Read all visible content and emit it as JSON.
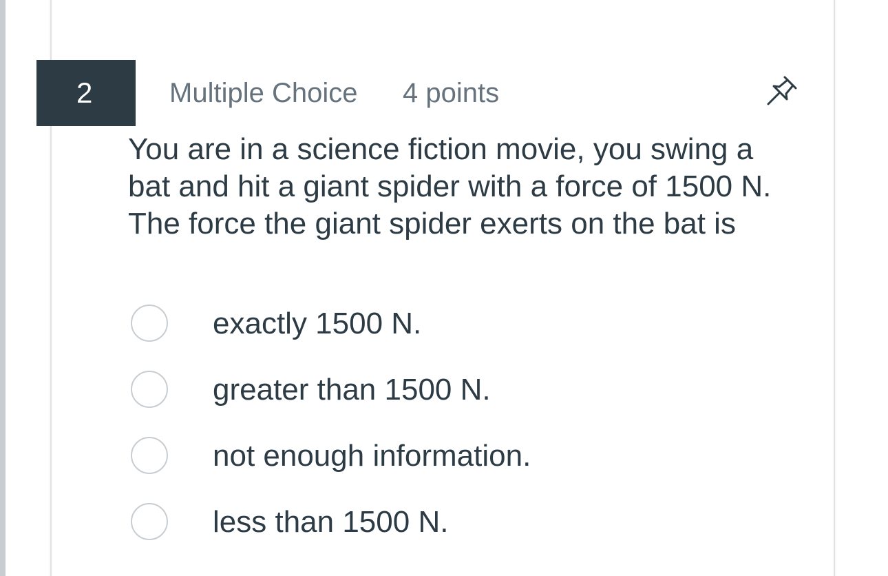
{
  "question": {
    "number": "2",
    "type": "Multiple Choice",
    "points": "4 points",
    "text": "You are in a science fiction movie, you swing a bat and hit a giant spider with a force of 1500 N. The force the giant spider exerts on the bat is",
    "pin_icon": "pin-icon"
  },
  "answers": [
    {
      "label": "exactly 1500 N.",
      "selected": false
    },
    {
      "label": "greater than 1500 N.",
      "selected": false
    },
    {
      "label": "not enough information.",
      "selected": false
    },
    {
      "label": "less than 1500 N.",
      "selected": false
    }
  ],
  "colors": {
    "accent": "#2d3b45",
    "muted_text": "#66737d",
    "radio_border": "#c7cdd1"
  }
}
